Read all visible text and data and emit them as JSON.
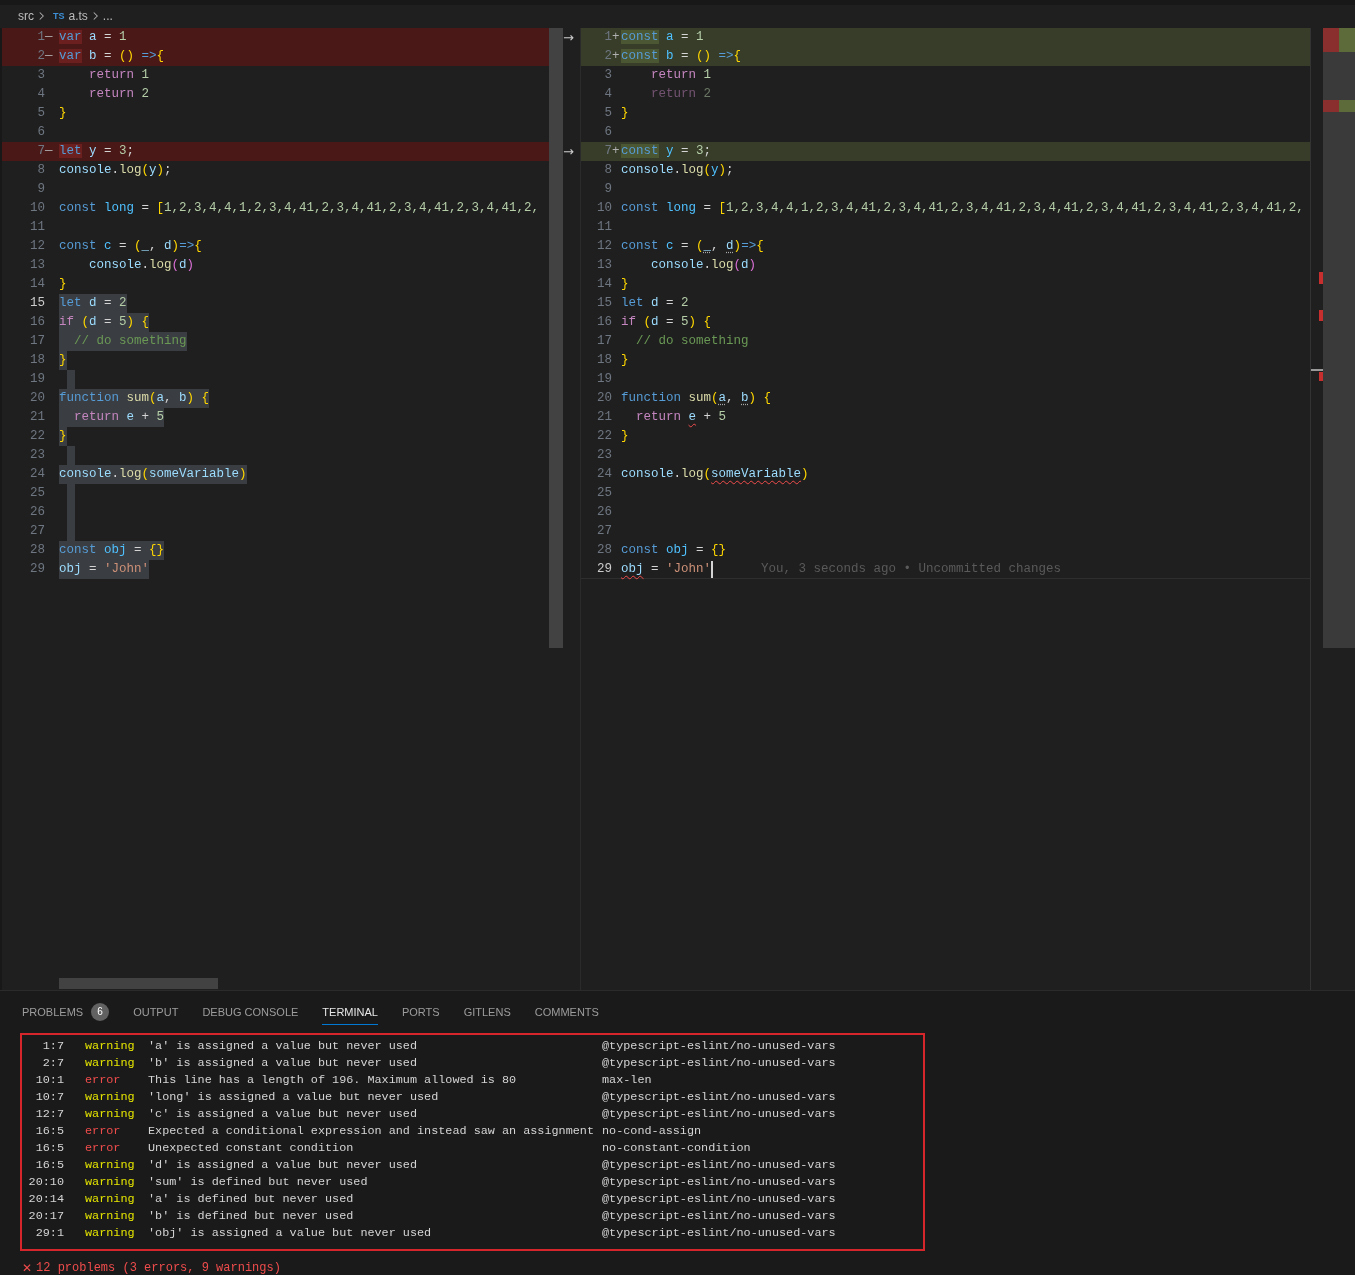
{
  "breadcrumb": {
    "folder": "src",
    "file_icon": "TS",
    "file": "a.ts",
    "more": "..."
  },
  "left": {
    "lines": [
      {
        "number": "1",
        "marker": "—",
        "removed": true,
        "selected": false,
        "current": false,
        "tokens": [
          {
            "kind": "kw",
            "text": "var",
            "changed": true
          },
          {
            "kind": "var",
            "text": " a",
            "changed": false
          },
          {
            "kind": "op",
            "text": " = ",
            "changed": false
          },
          {
            "kind": "num",
            "text": "1",
            "changed": false
          }
        ]
      },
      {
        "number": "2",
        "marker": "—",
        "removed": true,
        "selected": false,
        "current": false,
        "tokens": [
          {
            "kind": "kw",
            "text": "var",
            "changed": true
          },
          {
            "kind": "var",
            "text": " b",
            "changed": false
          },
          {
            "kind": "op",
            "text": " = ",
            "changed": false
          },
          {
            "kind": "br",
            "text": "()",
            "changed": false
          },
          {
            "kind": "kw",
            "text": " =>",
            "changed": false
          },
          {
            "kind": "br",
            "text": "{",
            "changed": false
          }
        ]
      },
      {
        "number": "3",
        "removed": false,
        "selected": false,
        "current": false,
        "tokens": [
          {
            "kind": "ctrl",
            "text": "    return"
          },
          {
            "kind": "num",
            "text": " 1"
          }
        ]
      },
      {
        "number": "4",
        "removed": false,
        "selected": false,
        "current": false,
        "tokens": [
          {
            "kind": "ctrl",
            "text": "    return"
          },
          {
            "kind": "num",
            "text": " 2"
          }
        ]
      },
      {
        "number": "5",
        "removed": false,
        "selected": false,
        "current": false,
        "tokens": [
          {
            "kind": "br",
            "text": "}"
          }
        ]
      },
      {
        "number": "6",
        "removed": false,
        "selected": false,
        "current": false
      },
      {
        "number": "7",
        "marker": "—",
        "removed": true,
        "selected": false,
        "current": false,
        "tokens": [
          {
            "kind": "kw",
            "text": "let",
            "changed": true
          },
          {
            "kind": "var",
            "text": " y",
            "changed": false
          },
          {
            "kind": "op",
            "text": " = ",
            "changed": false
          },
          {
            "kind": "num",
            "text": "3",
            "changed": false
          },
          {
            "kind": "op",
            "text": ";",
            "changed": false
          }
        ]
      },
      {
        "number": "8",
        "removed": false,
        "selected": false,
        "current": false,
        "tokens": [
          {
            "kind": "var",
            "text": "console"
          },
          {
            "kind": "op",
            "text": "."
          },
          {
            "kind": "fn",
            "text": "log"
          },
          {
            "kind": "br",
            "text": "("
          },
          {
            "kind": "var",
            "text": "y"
          },
          {
            "kind": "br",
            "text": ")"
          },
          {
            "kind": "op",
            "text": ";"
          }
        ]
      },
      {
        "number": "9",
        "removed": false,
        "selected": false,
        "current": false
      },
      {
        "number": "10",
        "removed": false,
        "selected": false,
        "current": false,
        "tokens": [
          {
            "kind": "kw",
            "text": "const"
          },
          {
            "kind": "cst",
            "text": " long"
          },
          {
            "kind": "op",
            "text": " = "
          },
          {
            "kind": "br",
            "text": "["
          },
          {
            "kind": "num",
            "text": "1,2,3,4,4,1,2,3,4,41,2,3,4,41,2,3,4,41,2,3,4,41,2,"
          }
        ]
      },
      {
        "number": "11",
        "removed": false,
        "selected": false,
        "current": false
      },
      {
        "number": "12",
        "removed": false,
        "selected": false,
        "current": false,
        "tokens": [
          {
            "kind": "kw",
            "text": "const"
          },
          {
            "kind": "cst",
            "text": " c"
          },
          {
            "kind": "op",
            "text": " = "
          },
          {
            "kind": "br",
            "text": "("
          },
          {
            "kind": "var",
            "text": "_"
          },
          {
            "kind": "op",
            "text": ", "
          },
          {
            "kind": "var",
            "text": "d"
          },
          {
            "kind": "br",
            "text": ")"
          },
          {
            "kind": "kw",
            "text": "=>"
          },
          {
            "kind": "br",
            "text": "{"
          }
        ]
      },
      {
        "number": "13",
        "removed": false,
        "selected": false,
        "current": false,
        "tokens": [
          {
            "kind": "var",
            "text": "    console"
          },
          {
            "kind": "op",
            "text": "."
          },
          {
            "kind": "fn",
            "text": "log"
          },
          {
            "kind": "br2",
            "text": "("
          },
          {
            "kind": "var",
            "text": "d"
          },
          {
            "kind": "br2",
            "text": ")"
          }
        ]
      },
      {
        "number": "14",
        "removed": false,
        "selected": false,
        "current": false,
        "tokens": [
          {
            "kind": "br",
            "text": "}"
          }
        ]
      },
      {
        "number": "15",
        "removed": false,
        "selected": true,
        "current": true,
        "tokens": [
          {
            "kind": "kw",
            "text": "let"
          },
          {
            "kind": "var",
            "text": " d"
          },
          {
            "kind": "op",
            "text": " = "
          },
          {
            "kind": "num",
            "text": "2"
          }
        ]
      },
      {
        "number": "16",
        "removed": false,
        "selected": true,
        "current": false,
        "tokens": [
          {
            "kind": "ctrl",
            "text": "if"
          },
          {
            "kind": "br",
            "text": " ("
          },
          {
            "kind": "var",
            "text": "d"
          },
          {
            "kind": "op",
            "text": " = "
          },
          {
            "kind": "num",
            "text": "5"
          },
          {
            "kind": "br",
            "text": ")"
          },
          {
            "kind": "br",
            "text": " {"
          }
        ]
      },
      {
        "number": "17",
        "removed": false,
        "selected": true,
        "current": false,
        "tokens": [
          {
            "kind": "cmt",
            "text": "  // do something"
          }
        ]
      },
      {
        "number": "18",
        "removed": false,
        "selected": true,
        "current": false,
        "tokens": [
          {
            "kind": "br",
            "text": "}"
          }
        ]
      },
      {
        "number": "19",
        "removed": false,
        "selected": true,
        "current": false
      },
      {
        "number": "20",
        "removed": false,
        "selected": true,
        "current": false,
        "tokens": [
          {
            "kind": "kw",
            "text": "function"
          },
          {
            "kind": "fn",
            "text": " sum"
          },
          {
            "kind": "br",
            "text": "("
          },
          {
            "kind": "var",
            "text": "a"
          },
          {
            "kind": "op",
            "text": ", "
          },
          {
            "kind": "var",
            "text": "b"
          },
          {
            "kind": "br",
            "text": ")"
          },
          {
            "kind": "br",
            "text": " {"
          }
        ]
      },
      {
        "number": "21",
        "removed": false,
        "selected": true,
        "current": false,
        "tokens": [
          {
            "kind": "ctrl",
            "text": "  return"
          },
          {
            "kind": "var",
            "text": " e"
          },
          {
            "kind": "op",
            "text": " + "
          },
          {
            "kind": "num",
            "text": "5"
          }
        ]
      },
      {
        "number": "22",
        "removed": false,
        "selected": true,
        "current": false,
        "tokens": [
          {
            "kind": "br",
            "text": "}"
          }
        ]
      },
      {
        "number": "23",
        "removed": false,
        "selected": true,
        "current": false
      },
      {
        "number": "24",
        "removed": false,
        "selected": true,
        "current": false,
        "tokens": [
          {
            "kind": "var",
            "text": "console"
          },
          {
            "kind": "op",
            "text": "."
          },
          {
            "kind": "fn",
            "text": "log"
          },
          {
            "kind": "br",
            "text": "("
          },
          {
            "kind": "var",
            "text": "someVariable"
          },
          {
            "kind": "br",
            "text": ")"
          }
        ]
      },
      {
        "number": "25",
        "removed": false,
        "selected": true,
        "current": false
      },
      {
        "number": "26",
        "removed": false,
        "selected": true,
        "current": false
      },
      {
        "number": "27",
        "removed": false,
        "selected": true,
        "current": false
      },
      {
        "number": "28",
        "removed": false,
        "selected": true,
        "current": false,
        "tokens": [
          {
            "kind": "kw",
            "text": "const"
          },
          {
            "kind": "cst",
            "text": " obj"
          },
          {
            "kind": "op",
            "text": " = "
          },
          {
            "kind": "br",
            "text": "{}"
          }
        ]
      },
      {
        "number": "29",
        "removed": false,
        "selected": true,
        "current": false,
        "tokens": [
          {
            "kind": "var",
            "text": "obj"
          },
          {
            "kind": "op",
            "text": " = "
          },
          {
            "kind": "str",
            "text": "'John'"
          }
        ]
      }
    ]
  },
  "right": {
    "lines": [
      {
        "number": "1",
        "marker": "+",
        "added": true,
        "gutter_arrow": "→",
        "current": false,
        "tokens": [
          {
            "kind": "kw",
            "text": "const",
            "changed": true
          },
          {
            "kind": "cst",
            "text": " a",
            "changed": false
          },
          {
            "kind": "op",
            "text": " = ",
            "changed": false
          },
          {
            "kind": "num",
            "text": "1",
            "changed": false
          }
        ]
      },
      {
        "number": "2",
        "marker": "+",
        "added": true,
        "current": false,
        "tokens": [
          {
            "kind": "kw",
            "text": "const",
            "changed": true
          },
          {
            "kind": "cst",
            "text": " b",
            "changed": false
          },
          {
            "kind": "op",
            "text": " = ",
            "changed": false
          },
          {
            "kind": "br",
            "text": "()",
            "changed": false
          },
          {
            "kind": "kw",
            "text": " =>",
            "changed": false
          },
          {
            "kind": "br",
            "text": "{",
            "changed": false
          }
        ]
      },
      {
        "number": "3",
        "added": false,
        "current": false,
        "tokens": [
          {
            "kind": "ctrl",
            "text": "    return"
          },
          {
            "kind": "num",
            "text": " 1"
          }
        ]
      },
      {
        "number": "4",
        "added": false,
        "current": false,
        "faded": true,
        "tokens": [
          {
            "kind": "ctrl",
            "text": "    return"
          },
          {
            "kind": "num",
            "text": " 2"
          }
        ]
      },
      {
        "number": "5",
        "added": false,
        "current": false,
        "tokens": [
          {
            "kind": "br",
            "text": "}"
          }
        ]
      },
      {
        "number": "6",
        "added": false,
        "current": false
      },
      {
        "number": "7",
        "marker": "+",
        "added": true,
        "gutter_arrow": "→",
        "current": false,
        "tokens": [
          {
            "kind": "kw",
            "text": "const",
            "changed": true
          },
          {
            "kind": "cst",
            "text": " y",
            "changed": false
          },
          {
            "kind": "op",
            "text": " = ",
            "changed": false
          },
          {
            "kind": "num",
            "text": "3",
            "changed": false
          },
          {
            "kind": "op",
            "text": ";",
            "changed": false
          }
        ]
      },
      {
        "number": "8",
        "added": false,
        "current": false,
        "tokens": [
          {
            "kind": "var",
            "text": "console"
          },
          {
            "kind": "op",
            "text": "."
          },
          {
            "kind": "fn",
            "text": "log"
          },
          {
            "kind": "br",
            "text": "("
          },
          {
            "kind": "cst",
            "text": "y"
          },
          {
            "kind": "br",
            "text": ")"
          },
          {
            "kind": "op",
            "text": ";"
          }
        ]
      },
      {
        "number": "9",
        "added": false,
        "current": false
      },
      {
        "number": "10",
        "added": false,
        "current": false,
        "tokens": [
          {
            "kind": "kw",
            "text": "const"
          },
          {
            "kind": "cst",
            "text": " long"
          },
          {
            "kind": "op",
            "text": " = "
          },
          {
            "kind": "br",
            "text": "["
          },
          {
            "kind": "num",
            "text": "1,2,3,4,4,1,2,3,4,41,2,3,4,41,2,3,4,41,2,3,4,41,2,3,4,41,2,3,4,41,2,3,4,41,2,"
          }
        ]
      },
      {
        "number": "11",
        "added": false,
        "current": false
      },
      {
        "number": "12",
        "added": false,
        "current": false,
        "tokens": [
          {
            "kind": "kw",
            "text": "const"
          },
          {
            "kind": "cst",
            "text": " c"
          },
          {
            "kind": "op",
            "text": " = "
          },
          {
            "kind": "br",
            "text": "("
          },
          {
            "kind": "var",
            "text": "_",
            "hint_squiggle": true
          },
          {
            "kind": "op",
            "text": ", "
          },
          {
            "kind": "var",
            "text": "d",
            "hint_squiggle": true
          },
          {
            "kind": "br",
            "text": ")"
          },
          {
            "kind": "kw",
            "text": "=>"
          },
          {
            "kind": "br",
            "text": "{"
          }
        ]
      },
      {
        "number": "13",
        "added": false,
        "current": false,
        "tokens": [
          {
            "kind": "var",
            "text": "    console"
          },
          {
            "kind": "op",
            "text": "."
          },
          {
            "kind": "fn",
            "text": "log"
          },
          {
            "kind": "br2",
            "text": "("
          },
          {
            "kind": "var",
            "text": "d"
          },
          {
            "kind": "br2",
            "text": ")"
          }
        ]
      },
      {
        "number": "14",
        "added": false,
        "current": false,
        "tokens": [
          {
            "kind": "br",
            "text": "}"
          }
        ]
      },
      {
        "number": "15",
        "added": false,
        "current": false,
        "tokens": [
          {
            "kind": "kw",
            "text": "let"
          },
          {
            "kind": "var",
            "text": " d"
          },
          {
            "kind": "op",
            "text": " = "
          },
          {
            "kind": "num",
            "text": "2"
          }
        ]
      },
      {
        "number": "16",
        "added": false,
        "current": false,
        "tokens": [
          {
            "kind": "ctrl",
            "text": "if"
          },
          {
            "kind": "br",
            "text": " ("
          },
          {
            "kind": "var",
            "text": "d"
          },
          {
            "kind": "op",
            "text": " = "
          },
          {
            "kind": "num",
            "text": "5"
          },
          {
            "kind": "br",
            "text": ")"
          },
          {
            "kind": "br",
            "text": " {"
          }
        ]
      },
      {
        "number": "17",
        "added": false,
        "current": false,
        "tokens": [
          {
            "kind": "cmt",
            "text": "  // do something"
          }
        ]
      },
      {
        "number": "18",
        "added": false,
        "current": false,
        "tokens": [
          {
            "kind": "br",
            "text": "}"
          }
        ]
      },
      {
        "number": "19",
        "added": false,
        "current": false
      },
      {
        "number": "20",
        "added": false,
        "current": false,
        "tokens": [
          {
            "kind": "kw",
            "text": "function"
          },
          {
            "kind": "fn",
            "text": " sum"
          },
          {
            "kind": "br",
            "text": "("
          },
          {
            "kind": "var",
            "text": "a",
            "hint_squiggle": true
          },
          {
            "kind": "op",
            "text": ", "
          },
          {
            "kind": "var",
            "text": "b",
            "hint_squiggle": true
          },
          {
            "kind": "br",
            "text": ")"
          },
          {
            "kind": "br",
            "text": " {"
          }
        ]
      },
      {
        "number": "21",
        "added": false,
        "current": false,
        "tokens": [
          {
            "kind": "ctrl",
            "text": "  return "
          },
          {
            "kind": "var",
            "text": "e",
            "error_squiggle": true
          },
          {
            "kind": "op",
            "text": " + "
          },
          {
            "kind": "num",
            "text": "5"
          }
        ]
      },
      {
        "number": "22",
        "added": false,
        "current": false,
        "tokens": [
          {
            "kind": "br",
            "text": "}"
          }
        ]
      },
      {
        "number": "23",
        "added": false,
        "current": false
      },
      {
        "number": "24",
        "added": false,
        "current": false,
        "tokens": [
          {
            "kind": "var",
            "text": "console"
          },
          {
            "kind": "op",
            "text": "."
          },
          {
            "kind": "fn",
            "text": "log"
          },
          {
            "kind": "br",
            "text": "("
          },
          {
            "kind": "var",
            "text": "someVariable",
            "error_squiggle": true
          },
          {
            "kind": "br",
            "text": ")"
          }
        ]
      },
      {
        "number": "25",
        "added": false,
        "current": false
      },
      {
        "number": "26",
        "added": false,
        "current": false
      },
      {
        "number": "27",
        "added": false,
        "current": false
      },
      {
        "number": "28",
        "added": false,
        "current": false,
        "tokens": [
          {
            "kind": "kw",
            "text": "const"
          },
          {
            "kind": "cst",
            "text": " obj"
          },
          {
            "kind": "op",
            "text": " = "
          },
          {
            "kind": "br",
            "text": "{}"
          }
        ]
      },
      {
        "number": "29",
        "added": false,
        "current": true,
        "cursor": true,
        "blame": "You, 3 seconds ago • Uncommitted changes",
        "tokens": [
          {
            "kind": "var",
            "text": "obj",
            "error_squiggle": true
          },
          {
            "kind": "op",
            "text": " = "
          },
          {
            "kind": "str",
            "text": "'John'"
          }
        ]
      }
    ]
  },
  "panel": {
    "tabs": [
      {
        "label": "PROBLEMS",
        "badge": "6",
        "selected": false
      },
      {
        "label": "OUTPUT",
        "selected": false
      },
      {
        "label": "DEBUG CONSOLE",
        "selected": false
      },
      {
        "label": "TERMINAL",
        "selected": true
      },
      {
        "label": "PORTS",
        "selected": false
      },
      {
        "label": "GITLENS",
        "selected": false
      },
      {
        "label": "COMMENTS",
        "selected": false
      }
    ],
    "problems": [
      {
        "position": "1:7",
        "severity": "warning",
        "message": "'a' is assigned a value but never used",
        "rule": "@typescript-eslint/no-unused-vars"
      },
      {
        "position": "2:7",
        "severity": "warning",
        "message": "'b' is assigned a value but never used",
        "rule": "@typescript-eslint/no-unused-vars"
      },
      {
        "position": "10:1",
        "severity": "error",
        "message": "This line has a length of 196. Maximum allowed is 80",
        "rule": "max-len"
      },
      {
        "position": "10:7",
        "severity": "warning",
        "message": "'long' is assigned a value but never used",
        "rule": "@typescript-eslint/no-unused-vars"
      },
      {
        "position": "12:7",
        "severity": "warning",
        "message": "'c' is assigned a value but never used",
        "rule": "@typescript-eslint/no-unused-vars"
      },
      {
        "position": "16:5",
        "severity": "error",
        "message": "Expected a conditional expression and instead saw an assignment",
        "rule": "no-cond-assign"
      },
      {
        "position": "16:5",
        "severity": "error",
        "message": "Unexpected constant condition",
        "rule": "no-constant-condition"
      },
      {
        "position": "16:5",
        "severity": "warning",
        "message": "'d' is assigned a value but never used",
        "rule": "@typescript-eslint/no-unused-vars"
      },
      {
        "position": "20:10",
        "severity": "warning",
        "message": "'sum' is defined but never used",
        "rule": "@typescript-eslint/no-unused-vars"
      },
      {
        "position": "20:14",
        "severity": "warning",
        "message": "'a' is defined but never used",
        "rule": "@typescript-eslint/no-unused-vars"
      },
      {
        "position": "20:17",
        "severity": "warning",
        "message": "'b' is defined but never used",
        "rule": "@typescript-eslint/no-unused-vars"
      },
      {
        "position": "29:1",
        "severity": "warning",
        "message": "'obj' is assigned a value but never used",
        "rule": "@typescript-eslint/no-unused-vars"
      }
    ],
    "summary_icon": "✕",
    "summary": "12 problems (3 errors, 9 warnings)"
  }
}
